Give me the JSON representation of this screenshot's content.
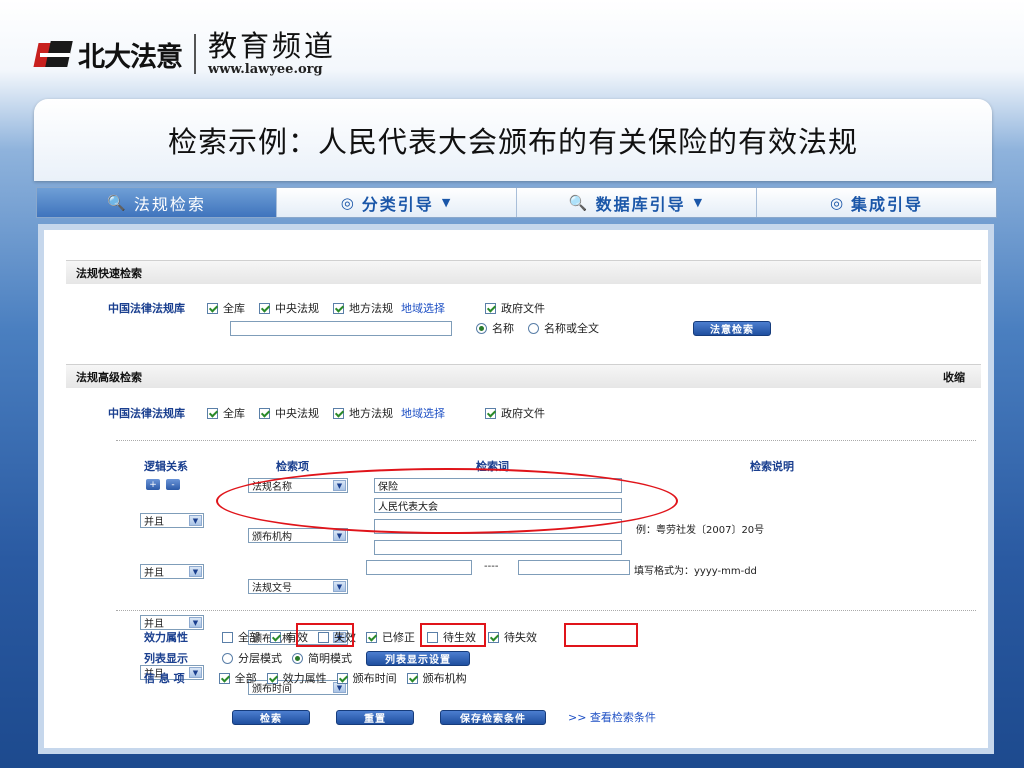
{
  "header": {
    "logo_text": "北大法意",
    "channel_title": "教育频道",
    "channel_url": "www.lawyee.org"
  },
  "slide_title": "检索示例：人民代表大会颁布的有关保险的有效法规",
  "nav": {
    "tabs": [
      {
        "label": "法规检索",
        "icon": "search-icon",
        "active": true
      },
      {
        "label": "分类引导",
        "icon": "target-icon",
        "has_dropdown": true
      },
      {
        "label": "数据库引导",
        "icon": "search-icon",
        "has_dropdown": true
      },
      {
        "label": "集成引导",
        "icon": "target-icon"
      }
    ]
  },
  "quick_search": {
    "header": "法规快速检索",
    "library_label": "中国法律法规库",
    "options": [
      "全库",
      "中央法规",
      "地方法规"
    ],
    "region_link": "地域选择",
    "gov_docs": "政府文件",
    "input_value": "",
    "scope_options": [
      "名称",
      "名称或全文"
    ],
    "selected_scope": "名称",
    "search_button": "法意检索"
  },
  "advanced_search": {
    "header": "法规高级检索",
    "collapse": "收缩",
    "library_label": "中国法律法规库",
    "options": [
      "全库",
      "中央法规",
      "地方法规"
    ],
    "region_link": "地域选择",
    "gov_docs": "政府文件",
    "columns": {
      "logic": "逻辑关系",
      "field": "检索项",
      "term": "检索词",
      "note": "检索说明"
    },
    "add_symbol": "+",
    "remove_symbol": "-",
    "rows": [
      {
        "logic": "",
        "field": "法规名称",
        "term": "保险",
        "note": ""
      },
      {
        "logic": "并且",
        "field": "颁布机构",
        "term": "人民代表大会",
        "note": ""
      },
      {
        "logic": "并且",
        "field": "法规文号",
        "term": "",
        "note": "例：粤劳社发〔2007〕20号"
      },
      {
        "logic": "并且",
        "field": "颁布机构",
        "term": "",
        "note": ""
      },
      {
        "logic": "并且",
        "field": "颁布时间",
        "term": "",
        "note": "填写格式为：yyyy-mm-dd"
      }
    ],
    "date_separator": "----",
    "validity": {
      "label": "效力属性",
      "options": [
        {
          "label": "全部",
          "checked": false
        },
        {
          "label": "有效",
          "checked": true
        },
        {
          "label": "失效",
          "checked": false
        },
        {
          "label": "已修正",
          "checked": true
        },
        {
          "label": "待生效",
          "checked": false
        },
        {
          "label": "待失效",
          "checked": true
        }
      ]
    },
    "list_display": {
      "label": "列表显示",
      "options": [
        "分层模式",
        "简明模式"
      ],
      "selected": "简明模式",
      "settings_button": "列表显示设置"
    },
    "info_items": {
      "label": "信 息 项",
      "options": [
        "全部",
        "效力属性",
        "颁布时间",
        "颁布机构"
      ]
    },
    "buttons": {
      "search": "检索",
      "reset": "重置",
      "save": "保存检索条件",
      "view_link": ">> 查看检索条件"
    }
  },
  "colors": {
    "annotation": "#e0141a",
    "label_blue": "#1a3f8f",
    "button_blue": "#1f4f9f"
  }
}
